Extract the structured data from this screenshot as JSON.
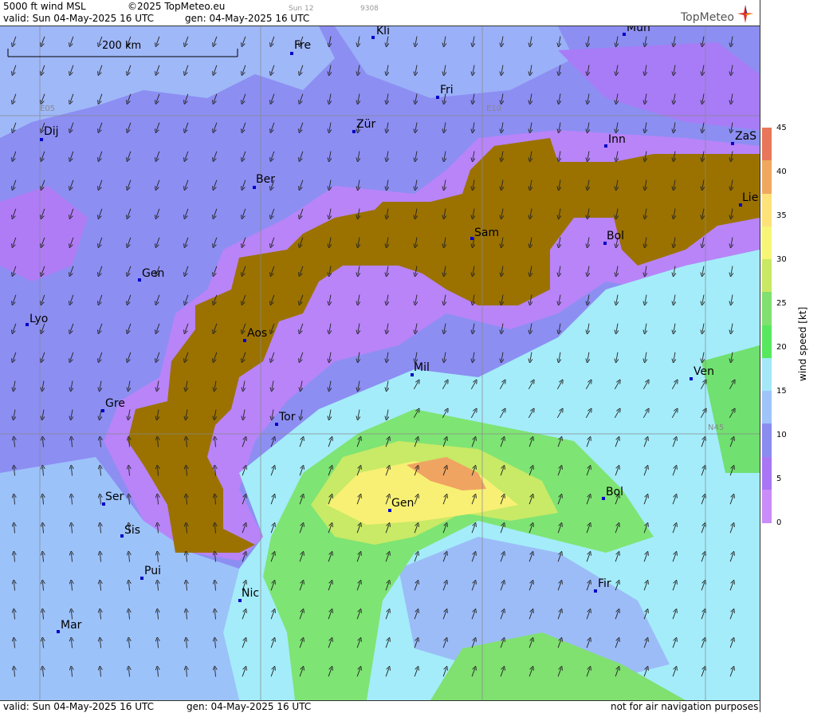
{
  "header": {
    "product": "5000 ft wind MSL",
    "copyright": "©2025 TopMeteo.eu",
    "valid": "valid:  Sun  04-May-2025  16 UTC",
    "generated": "gen: 04-May-2025 16 UTC",
    "small_a": "Sun 12",
    "small_b": "9308",
    "logo": "TopMeteo"
  },
  "footer": {
    "valid": "valid:  Sun  04-May-2025  16 UTC",
    "generated": "gen: 04-May-2025 16 UTC",
    "disclaimer": "not for air navigation purposes"
  },
  "scale_bar": {
    "label": "200 km"
  },
  "grid_labels": {
    "e05": "E05",
    "e10": "E10",
    "n45": "N45"
  },
  "legend": {
    "unit_label": "wind speed [kt]",
    "ticks": [
      "45",
      "40",
      "35",
      "30",
      "25",
      "20",
      "15",
      "10",
      "5",
      "0"
    ],
    "colors": [
      "#e8765a",
      "#f0a860",
      "#fde27a",
      "#f6f576",
      "#c9e864",
      "#80e070",
      "#58e860",
      "#a4e8f8",
      "#9fc4fa",
      "#8a8cf0",
      "#a876f4",
      "#c98cf8"
    ]
  },
  "terrain_color": "#9b7200",
  "cities": [
    {
      "name": "Kli"
    },
    {
      "name": "Mün"
    },
    {
      "name": "Fre"
    },
    {
      "name": "Fri"
    },
    {
      "name": "Dij"
    },
    {
      "name": "Zür"
    },
    {
      "name": "Inn"
    },
    {
      "name": "ZaS"
    },
    {
      "name": "Ber"
    },
    {
      "name": "Lie"
    },
    {
      "name": "Sam"
    },
    {
      "name": "Bol"
    },
    {
      "name": "Gen"
    },
    {
      "name": "Lyo"
    },
    {
      "name": "Aos"
    },
    {
      "name": "Mil"
    },
    {
      "name": "Ven"
    },
    {
      "name": "Gre"
    },
    {
      "name": "Tor"
    },
    {
      "name": "Ser"
    },
    {
      "name": "Gen"
    },
    {
      "name": "Bol"
    },
    {
      "name": "Sis"
    },
    {
      "name": "Pui"
    },
    {
      "name": "Nic"
    },
    {
      "name": "Fir"
    },
    {
      "name": "Mar"
    }
  ]
}
